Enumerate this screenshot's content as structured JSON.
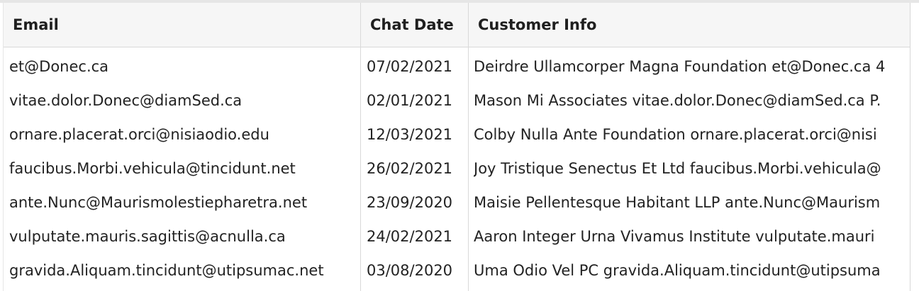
{
  "table": {
    "headers": {
      "email": "Email",
      "chat_date": "Chat Date",
      "customer_info": "Customer Info"
    },
    "rows": [
      {
        "email": "et@Donec.ca",
        "chat_date": "07/02/2021",
        "customer_info": "Deirdre Ullamcorper Magna Foundation et@Donec.ca 4"
      },
      {
        "email": "vitae.dolor.Donec@diamSed.ca",
        "chat_date": "02/01/2021",
        "customer_info": "Mason Mi Associates vitae.dolor.Donec@diamSed.ca P."
      },
      {
        "email": "ornare.placerat.orci@nisiaodio.edu",
        "chat_date": "12/03/2021",
        "customer_info": "Colby Nulla Ante Foundation ornare.placerat.orci@nisi"
      },
      {
        "email": "faucibus.Morbi.vehicula@tincidunt.net",
        "chat_date": "26/02/2021",
        "customer_info": "Joy Tristique Senectus Et Ltd faucibus.Morbi.vehicula@"
      },
      {
        "email": "ante.Nunc@Maurismolestiepharetra.net",
        "chat_date": "23/09/2020",
        "customer_info": "Maisie Pellentesque Habitant LLP ante.Nunc@Maurism"
      },
      {
        "email": "vulputate.mauris.sagittis@acnulla.ca",
        "chat_date": "24/02/2021",
        "customer_info": "Aaron Integer Urna Vivamus Institute vulputate.mauri"
      },
      {
        "email": "gravida.Aliquam.tincidunt@utipsumac.net",
        "chat_date": "03/08/2020",
        "customer_info": "Uma Odio Vel PC gravida.Aliquam.tincidunt@utipsuma"
      }
    ]
  }
}
